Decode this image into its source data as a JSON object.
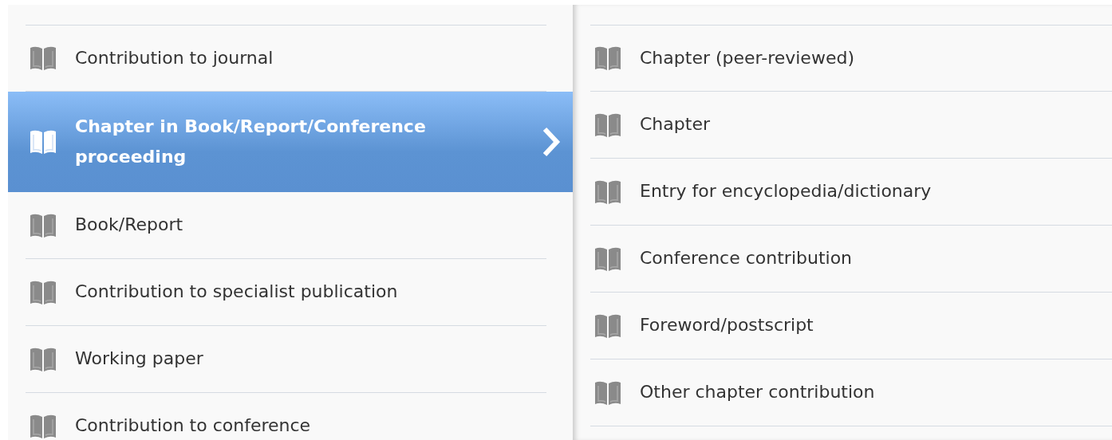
{
  "categories": [
    {
      "label": "Contribution to journal",
      "selected": false
    },
    {
      "label": "Chapter in Book/Report/Conference proceeding",
      "selected": true
    },
    {
      "label": "Book/Report",
      "selected": false
    },
    {
      "label": "Contribution to specialist publication",
      "selected": false
    },
    {
      "label": "Working paper",
      "selected": false
    },
    {
      "label": "Contribution to conference",
      "selected": false
    }
  ],
  "subtypes": [
    {
      "label": "Chapter (peer-reviewed)"
    },
    {
      "label": "Chapter"
    },
    {
      "label": "Entry for encyclopedia/dictionary"
    },
    {
      "label": "Conference contribution"
    },
    {
      "label": "Foreword/postscript"
    },
    {
      "label": "Other chapter contribution"
    }
  ]
}
